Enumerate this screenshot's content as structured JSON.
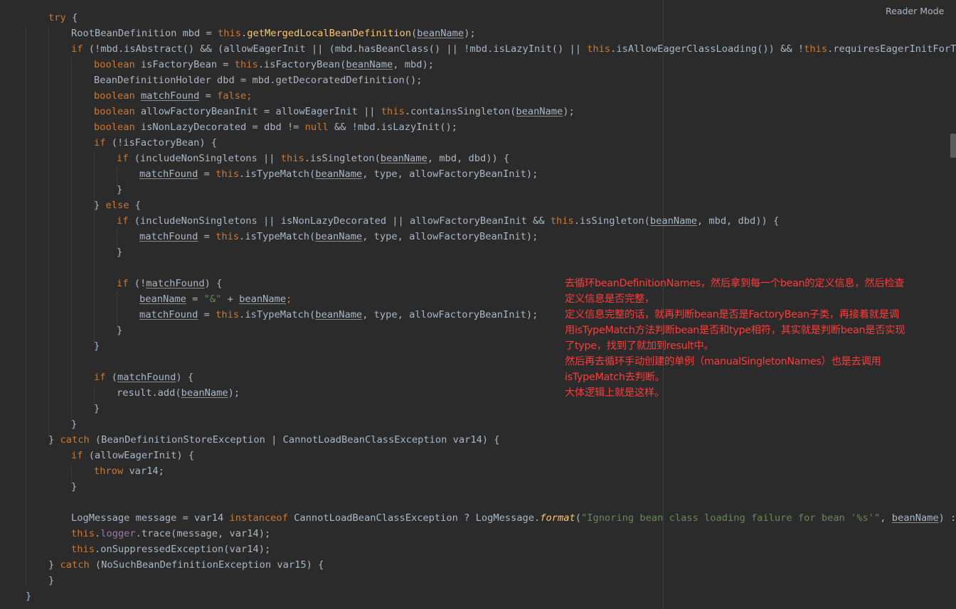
{
  "header": {
    "reader_mode_label": "Reader Mode"
  },
  "code": {
    "l1": {
      "t0": "try",
      "t1": " {"
    },
    "l2": {
      "t0": "RootBeanDefinition mbd = ",
      "t1": "this",
      "t2": ".",
      "t3": "getMergedLocalBeanDefinition",
      "t4": "(",
      "t5": "beanName",
      "t6": ");"
    },
    "l3": {
      "t0": "if",
      "t1": " (!mbd.isAbstract() && (allowEagerInit || (mbd.hasBeanClass() || !mbd.isLazyInit() || ",
      "t2": "this",
      "t3": ".isAllowEagerClassLoading()) && !",
      "t4": "this",
      "t5": ".requiresEagerInitForType(mbd"
    },
    "l4": {
      "t0": "boolean",
      "t1": " isFactoryBean = ",
      "t2": "this",
      "t3": ".isFactoryBean(",
      "t4": "beanName",
      "t5": ", mbd);"
    },
    "l5": {
      "t0": "BeanDefinitionHolder dbd = mbd.getDecoratedDefinition();"
    },
    "l6": {
      "t0": "boolean",
      "t1": " ",
      "t2": "matchFound",
      "t3": " = ",
      "t4": "false",
      "t5": ";"
    },
    "l7": {
      "t0": "boolean",
      "t1": " allowFactoryBeanInit = allowEagerInit || ",
      "t2": "this",
      "t3": ".containsSingleton(",
      "t4": "beanName",
      "t5": ");"
    },
    "l8": {
      "t0": "boolean",
      "t1": " isNonLazyDecorated = dbd != ",
      "t2": "null",
      "t3": " && !mbd.isLazyInit();"
    },
    "l9": {
      "t0": "if",
      "t1": " (!isFactoryBean) {"
    },
    "l10": {
      "t0": "if",
      "t1": " (includeNonSingletons || ",
      "t2": "this",
      "t3": ".isSingleton(",
      "t4": "beanName",
      "t5": ", mbd, dbd)) {"
    },
    "l11": {
      "t0": "matchFound",
      "t1": " = ",
      "t2": "this",
      "t3": ".isTypeMatch(",
      "t4": "beanName",
      "t5": ", type, allowFactoryBeanInit);"
    },
    "l12": {
      "t0": "}"
    },
    "l13": {
      "t0": "} ",
      "t1": "else",
      "t2": " {"
    },
    "l14": {
      "t0": "if",
      "t1": " (includeNonSingletons || isNonLazyDecorated || allowFactoryBeanInit && ",
      "t2": "this",
      "t3": ".isSingleton(",
      "t4": "beanName",
      "t5": ", mbd, dbd)) {"
    },
    "l15": {
      "t0": "matchFound",
      "t1": " = ",
      "t2": "this",
      "t3": ".isTypeMatch(",
      "t4": "beanName",
      "t5": ", type, allowFactoryBeanInit);"
    },
    "l16": {
      "t0": "}"
    },
    "l17": {
      "t0": "if",
      "t1": " (!",
      "t2": "matchFound",
      "t3": ") {"
    },
    "l18": {
      "t0": "beanName",
      "t1": " = ",
      "t2": "\"&\"",
      "t3": " + ",
      "t4": "beanName",
      "t5": ";"
    },
    "l19": {
      "t0": "matchFound",
      "t1": " = ",
      "t2": "this",
      "t3": ".isTypeMatch(",
      "t4": "beanName",
      "t5": ", type, allowFactoryBeanInit);"
    },
    "l20": {
      "t0": "}"
    },
    "l21": {
      "t0": "}"
    },
    "l22": {
      "t0": "if",
      "t1": " (",
      "t2": "matchFound",
      "t3": ") {"
    },
    "l23": {
      "t0": "result.add(",
      "t1": "beanName",
      "t2": ");"
    },
    "l24": {
      "t0": "}"
    },
    "l25": {
      "t0": "}"
    },
    "l26": {
      "t0": "} ",
      "t1": "catch",
      "t2": " (BeanDefinitionStoreException | CannotLoadBeanClassException var14) {"
    },
    "l27": {
      "t0": "if",
      "t1": " (allowEagerInit) {"
    },
    "l28": {
      "t0": "throw",
      "t1": " var14;"
    },
    "l29": {
      "t0": "}"
    },
    "l30": {
      "t0": "LogMessage message = var14 ",
      "t1": "instanceof",
      "t2": " CannotLoadBeanClassException ? LogMessage.",
      "t3": "format",
      "t4": "(",
      "t5": "\"Ignoring bean class loading failure for bean '%s'\"",
      "t6": ", ",
      "t7": "beanName",
      "t8": ") : LogMess"
    },
    "l31": {
      "t0": "this",
      "t1": ".",
      "t2": "logger",
      "t3": ".trace(message, var14);"
    },
    "l32": {
      "t0": "this",
      "t1": ".onSuppressedException(var14);"
    },
    "l33": {
      "t0": "} ",
      "t1": "catch",
      "t2": " (NoSuchBeanDefinitionException var15) {"
    },
    "l34": {
      "t0": "}"
    },
    "l35": {
      "t0": "}"
    }
  },
  "annotation": {
    "lines": [
      "去循环beanDefinitionNames，然后拿到每一个bean的定义信息，然后检查",
      "定义信息是否完整，",
      "定义信息完整的话，就再判断bean是否是FactoryBean子类，再接着就是调",
      "用isTypeMatch方法判断bean是否和type相符，其实就是判断bean是否实现",
      "了type，找到了就加到result中。",
      "然后再去循环手动创建的单例（manualSingletonNames）也是去调用",
      "isTypeMatch去判断。",
      "大体逻辑上就是这样。"
    ]
  },
  "colors": {
    "background": "#2b2b2b",
    "text": "#a9b7c6",
    "keyword": "#cc7832",
    "method": "#ffc66d",
    "string": "#6a8759",
    "field": "#9876aa",
    "annotation": "#ff3b3b"
  }
}
